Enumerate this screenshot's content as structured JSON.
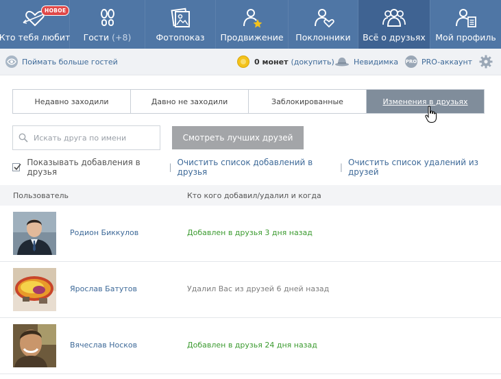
{
  "nav": {
    "items": [
      {
        "label": "Кто тебя любит",
        "badge": "НОВОЕ"
      },
      {
        "label": "Гости",
        "count": "(+8)"
      },
      {
        "label": "Фотопоказ"
      },
      {
        "label": "Продвижение"
      },
      {
        "label": "Поклонники"
      },
      {
        "label": "Всё о друзьях"
      },
      {
        "label": "Мой профиль"
      }
    ]
  },
  "subbar": {
    "more_guests": "Поймать больше гостей",
    "coins": "0 монет",
    "topup": "(докупить)",
    "invisible": "Невидимка",
    "pro_icon": "PRO",
    "pro": "PRO-аккаунт"
  },
  "tabs": [
    {
      "label": "Недавно заходили"
    },
    {
      "label": "Давно не заходили"
    },
    {
      "label": "Заблокированные"
    },
    {
      "label": "Изменения в друзьях",
      "active": true
    }
  ],
  "search": {
    "placeholder": "Искать друга по имени",
    "value": ""
  },
  "best_friends_button": "Смотреть лучших друзей",
  "options": {
    "show_added_checked": true,
    "show_added": "Показывать добавления в друзья",
    "clear_added": "Очистить список добавлений в друзья",
    "clear_removed": "Очистить список удалений из друзей"
  },
  "table": {
    "headers": {
      "user": "Пользователь",
      "who": "Кто кого добавил/удалил и когда"
    },
    "rows": [
      {
        "name": "Родион Биккулов",
        "status": "Добавлен в друзья 3 дня назад",
        "kind": "added"
      },
      {
        "name": "Ярослав Батутов",
        "status": "Удалил Вас из друзей 6 дней назад",
        "kind": "removed"
      },
      {
        "name": "Вячеслав Носков",
        "status": "Добавлен в друзья 24 дня назад",
        "kind": "added"
      }
    ]
  },
  "colors": {
    "nav_bg": "#4f76a5",
    "nav_active": "#3f6392",
    "link": "#3d6998",
    "added": "#3a9a2e",
    "removed": "#7d7d7d",
    "tab_active": "#808d9b"
  },
  "icons": [
    "heart-arrow-icon",
    "footprints-icon",
    "photos-icon",
    "person-star-icon",
    "person-heart-icon",
    "friends-group-icon",
    "profile-card-icon",
    "eye-icon",
    "coin-icon",
    "hat-icon",
    "pro-icon",
    "gear-icon",
    "search-icon",
    "checkmark-icon",
    "hand-cursor-icon"
  ]
}
